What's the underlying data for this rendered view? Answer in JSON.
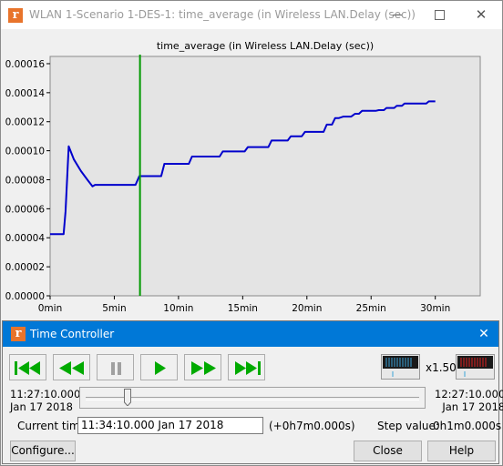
{
  "window": {
    "title": "WLAN 1-Scenario 1-DES-1: time_average (in Wireless LAN.Delay (sec))",
    "app_icon_letter": "r",
    "controls": [
      "minimize-icon",
      "maximize-icon",
      "close-icon"
    ]
  },
  "chart_data": {
    "type": "line",
    "title": "time_average (in Wireless LAN.Delay (sec))",
    "xlabel": "",
    "ylabel": "",
    "x_unit": "min",
    "xlim": [
      0,
      33.5
    ],
    "ylim": [
      0,
      0.000165
    ],
    "x_ticks": [
      {
        "value": 0,
        "label": "0min"
      },
      {
        "value": 5,
        "label": "5min"
      },
      {
        "value": 10,
        "label": "10min"
      },
      {
        "value": 15,
        "label": "15min"
      },
      {
        "value": 20,
        "label": "20min"
      },
      {
        "value": 25,
        "label": "25min"
      },
      {
        "value": 30,
        "label": "30min"
      }
    ],
    "y_ticks": [
      {
        "value": 0,
        "label": "0.00000"
      },
      {
        "value": 2e-05,
        "label": "0.00002"
      },
      {
        "value": 4e-05,
        "label": "0.00004"
      },
      {
        "value": 6e-05,
        "label": "0.00006"
      },
      {
        "value": 8e-05,
        "label": "0.00008"
      },
      {
        "value": 0.0001,
        "label": "0.00010"
      },
      {
        "value": 0.00012,
        "label": "0.00012"
      },
      {
        "value": 0.00014,
        "label": "0.00014"
      },
      {
        "value": 0.00016,
        "label": "0.00016"
      }
    ],
    "grid": false,
    "line_color": "#0000cc",
    "background": "#e4e4e4",
    "cursor_color": "#009900",
    "cursor_x": 7.0,
    "series": [
      {
        "x": [
          0,
          1.05,
          1.2,
          1.45,
          1.85,
          2.4,
          2.9,
          3.3,
          3.5,
          6.65,
          6.95,
          8.65,
          8.9,
          10.8,
          11.05,
          13.2,
          13.45,
          15.15,
          15.4,
          17.0,
          17.25,
          18.5,
          18.75,
          19.6,
          19.85,
          21.3,
          21.55,
          21.95,
          22.2,
          22.5,
          22.85,
          23.45,
          23.75,
          24.05,
          24.3,
          25.35,
          25.6,
          26.0,
          26.2,
          26.8,
          27.0,
          27.4,
          27.6,
          29.3,
          29.5,
          30.0
        ],
        "y": [
          4.25e-05,
          4.25e-05,
          5.8e-05,
          0.000103,
          9.4e-05,
          8.6e-05,
          8e-05,
          7.55e-05,
          7.65e-05,
          7.65e-05,
          8.25e-05,
          8.25e-05,
          9.1e-05,
          9.1e-05,
          9.6e-05,
          9.6e-05,
          9.95e-05,
          9.95e-05,
          0.0001025,
          0.0001025,
          0.000107,
          0.000107,
          0.00011,
          0.00011,
          0.000113,
          0.000113,
          0.000118,
          0.000118,
          0.0001225,
          0.0001225,
          0.0001235,
          0.0001235,
          0.0001255,
          0.0001255,
          0.0001275,
          0.0001275,
          0.000128,
          0.000128,
          0.0001295,
          0.0001295,
          0.000131,
          0.000131,
          0.0001325,
          0.0001325,
          0.000134,
          0.000134
        ]
      }
    ]
  },
  "time_controller": {
    "title": "Time Controller",
    "close_icon": "close-icon",
    "transport": [
      {
        "name": "skip-to-start-button",
        "icon": "skip-to-start-icon",
        "color": "#00aa00"
      },
      {
        "name": "rewind-button",
        "icon": "rewind-icon",
        "color": "#00aa00"
      },
      {
        "name": "pause-button",
        "icon": "pause-icon",
        "color": "#a0a0a0"
      },
      {
        "name": "play-button",
        "icon": "play-icon",
        "color": "#00aa00"
      },
      {
        "name": "fast-forward-button",
        "icon": "fast-forward-icon",
        "color": "#00aa00"
      },
      {
        "name": "skip-to-end-button",
        "icon": "skip-to-end-icon",
        "color": "#00aa00"
      }
    ],
    "speed": "x1.50",
    "start": {
      "time": "11:27:10.000",
      "date": "Jan 17 2018"
    },
    "end": {
      "time": "12:27:10.000",
      "date": "Jan 17 2018"
    },
    "slider_fraction": 0.117,
    "current_time_label": "Current time:",
    "current_time_value": "11:34:10.000 Jan 17 2018",
    "offset": "(+0h7m0.000s)",
    "step_label": "Step value:",
    "step_value": "0h1m0.000s",
    "configure_label": "Configure...",
    "close_label": "Close",
    "help_label": "Help"
  }
}
